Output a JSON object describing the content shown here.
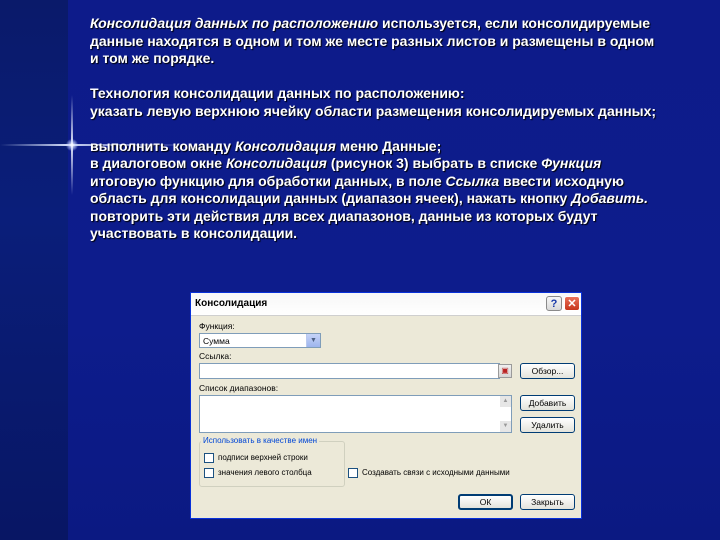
{
  "slide": {
    "p1_italic": "Консолидация данных по расположению",
    "p1_rest_line1": "используется, если консолидируемые",
    "p1_line2": "данные находятся в одном и том же месте разных листов и размещены в одном",
    "p1_line3": "и том же порядке.",
    "p2_line1": "Технология консолидации данных по расположению:",
    "p2_line2": "указать левую верхнюю ячейку области размещения консолидируемых данных;",
    "p3_line1_a": "выполнить команду",
    "p3_line1_it": "Консолидация",
    "p3_line1_b": "меню Данные;",
    "p3_line2_a": "в диалоговом окне",
    "p3_line2_it1": "Консолидация",
    "p3_line2_b": "(рисунок 3) выбрать в списке",
    "p3_line2_it2": "Функция",
    "p3_line3_a": "итоговую функцию для обработки данных, в поле",
    "p3_line3_it": "Ссылка",
    "p3_line3_b": "ввести исходную",
    "p3_line4_a": "область для консолидации данных (диапазон ячеек), нажать кнопку",
    "p3_line4_it": "Добавить.",
    "p3_line5": "повторить эти действия для всех диапазонов, данные из которых будут",
    "p3_line6": "участвовать в консолидации."
  },
  "dialog": {
    "title": "Консолидация",
    "help_label": "?",
    "close_label": "✕",
    "function_label": "Функция:",
    "function_value": "Сумма",
    "reference_label": "Ссылка:",
    "reference_value": "",
    "ranges_label": "Список диапазонов:",
    "browse_button": "Обзор...",
    "add_button": "Добавить",
    "delete_button": "Удалить",
    "use_labels_title": "Использовать в качестве имен",
    "top_row_label": "подписи верхней строки",
    "left_column_label": "значения левого столбца",
    "create_links_label": "Создавать связи с исходными данными",
    "ok_button": "ОК",
    "close_button": "Закрыть"
  },
  "icons": {
    "dropdown": "chevron-down-icon",
    "ref_collapse": "collapse-dialog-icon",
    "help": "help-icon",
    "close": "close-icon"
  },
  "colors": {
    "background": "#0c1a72",
    "panel": "#0d1b8a",
    "dialog_bg": "#ece9d8",
    "group_title": "#0046d5"
  }
}
